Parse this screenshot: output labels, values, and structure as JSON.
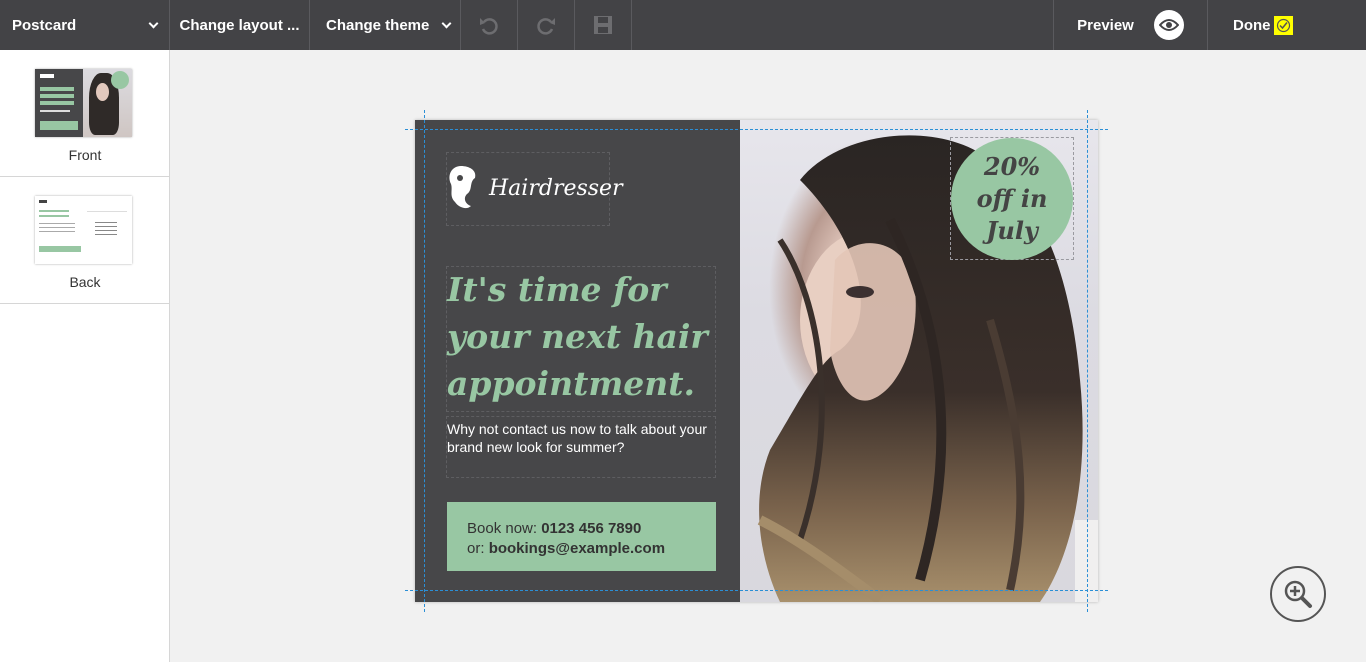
{
  "toolbar": {
    "document_type": "Postcard",
    "change_layout": "Change layout ...",
    "change_theme": "Change theme",
    "preview": "Preview",
    "done": "Done"
  },
  "sidebar": {
    "pages": [
      {
        "label": "Front"
      },
      {
        "label": "Back"
      }
    ]
  },
  "postcard": {
    "logo_text": "Hairdresser",
    "headline_lines": [
      "It's time for",
      "your next hair",
      "appointment."
    ],
    "subtext": "Why not contact us now to talk about your brand new look for summer?",
    "book_label": "Book now: ",
    "book_phone": "0123 456 7890",
    "book_or": "or: ",
    "book_email": "bookings@example.com",
    "badge_lines": [
      "20%",
      "off in",
      "July"
    ]
  },
  "colors": {
    "toolbar_bg": "#434346",
    "card_bg": "#474749",
    "accent_green": "#98c7a3",
    "done_check": "#ffff00",
    "guide_blue": "#2b8fd6"
  },
  "icons": [
    "chevron-down-icon",
    "undo-icon",
    "redo-icon",
    "save-icon",
    "eye-icon",
    "checkmark-icon",
    "zoom-in-icon"
  ]
}
